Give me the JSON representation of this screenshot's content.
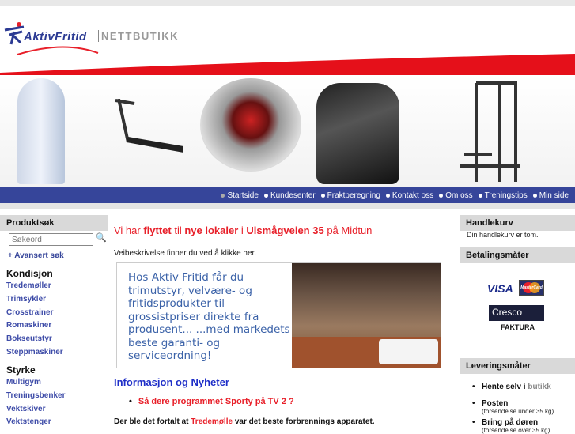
{
  "header": {
    "logo_text": "AktivFritid",
    "logo_sub": "NETTBUTIKK"
  },
  "nav": [
    {
      "label": "Startside"
    },
    {
      "label": "Kundesenter"
    },
    {
      "label": "Fraktberegning"
    },
    {
      "label": "Kontakt oss"
    },
    {
      "label": "Om oss"
    },
    {
      "label": "Treningstips"
    },
    {
      "label": "Min side"
    }
  ],
  "left": {
    "search_title": "Produktsøk",
    "search_placeholder": "Søkeord",
    "advanced": "Avansert søk",
    "categories": [
      {
        "title": "Kondisjon",
        "items": [
          "Tredemøller",
          "Trimsykler",
          "Crosstrainer",
          "Romaskiner",
          "Bokseutstyr",
          "Steppmaskiner"
        ]
      },
      {
        "title": "Styrke",
        "items": [
          "Multigym",
          "Treningsbenker",
          "Vektskiver",
          "Vektstenger"
        ]
      }
    ]
  },
  "main": {
    "moved": {
      "p1": "Vi har ",
      "p2": "flyttet",
      "p3": " til ",
      "p4": "nye lokaler",
      "p5": " i ",
      "p6": "Ulsmågveien 35",
      "p7": " på Midtun"
    },
    "directions": "Veibeskrivelse finner du ved å klikke her.",
    "banner_text": "Hos Aktiv Fritid får du trimutstyr, velvære- og fritidsprodukter til grossistpriser direkte fra produsent... ...med markedets beste garanti- og serviceordning!",
    "info_heading": "Informasjon og Nyheter",
    "news_item": "Så dere programmet  Sporty på TV 2 ?",
    "para": {
      "p1": "Der ble det fortalt at ",
      "link": "Tredemølle",
      "p2": " var det beste forbrennings apparatet."
    }
  },
  "right": {
    "cart_title": "Handlekurv",
    "cart_empty": "Din handlekurv er tom.",
    "payment_title": "Betalingsmåter",
    "visa": "VISA",
    "mastercard": "MasterCard",
    "cresco": "Cresco",
    "faktura": "FAKTURA",
    "delivery_title": "Leveringsmåter",
    "delivery": [
      {
        "label": "Hente selv i ",
        "extra": "butikk"
      },
      {
        "label": "Posten",
        "note": "(forsendelse under 35 kg)"
      },
      {
        "label": "Bring på døren",
        "note": "(forsendelse over 35 kg)"
      }
    ]
  },
  "colors": {
    "nav": "#36459a",
    "red": "#e8202a",
    "link": "#3e4ca8"
  }
}
